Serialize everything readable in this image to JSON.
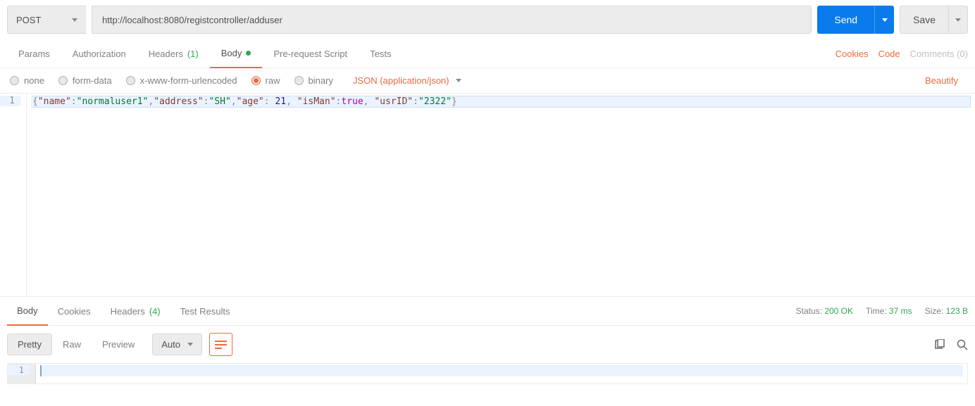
{
  "request": {
    "method": "POST",
    "url": "http://localhost:8080/registcontroller/adduser",
    "send_label": "Send",
    "save_label": "Save"
  },
  "req_tabs": {
    "params": "Params",
    "authorization": "Authorization",
    "headers": "Headers",
    "headers_count": "(1)",
    "body": "Body",
    "prerequest": "Pre-request Script",
    "tests": "Tests"
  },
  "req_right": {
    "cookies": "Cookies",
    "code": "Code",
    "comments": "Comments (0)"
  },
  "body_types": {
    "none": "none",
    "form_data": "form-data",
    "xwww": "x-www-form-urlencoded",
    "raw": "raw",
    "binary": "binary",
    "content_type": "JSON (application/json)",
    "beautify": "Beautify"
  },
  "editor": {
    "line_no": "1",
    "tokens": {
      "lb": "{",
      "k_name": "\"name\"",
      "v_name": "\"normaluser1\"",
      "k_addr": "\"address\"",
      "v_addr": "\"SH\"",
      "k_age": "\"age\"",
      "v_age": "21",
      "k_isman": "\"isMan\"",
      "v_isman": "true",
      "k_usrid": "\"usrID\"",
      "v_usrid": "\"2322\"",
      "rb": "}",
      "colon": ":",
      "comma": ",",
      "colon_sp": ": ",
      "comma_sp": ", "
    }
  },
  "resp_tabs": {
    "body": "Body",
    "cookies": "Cookies",
    "headers": "Headers",
    "headers_count": "(4)",
    "test_results": "Test Results"
  },
  "resp_status": {
    "status_lbl": "Status:",
    "status_val": "200 OK",
    "time_lbl": "Time:",
    "time_val": "37 ms",
    "size_lbl": "Size:",
    "size_val": "123 B"
  },
  "resp_toolbar": {
    "pretty": "Pretty",
    "raw": "Raw",
    "preview": "Preview",
    "format": "Auto"
  },
  "resp_editor": {
    "line_no": "1"
  }
}
